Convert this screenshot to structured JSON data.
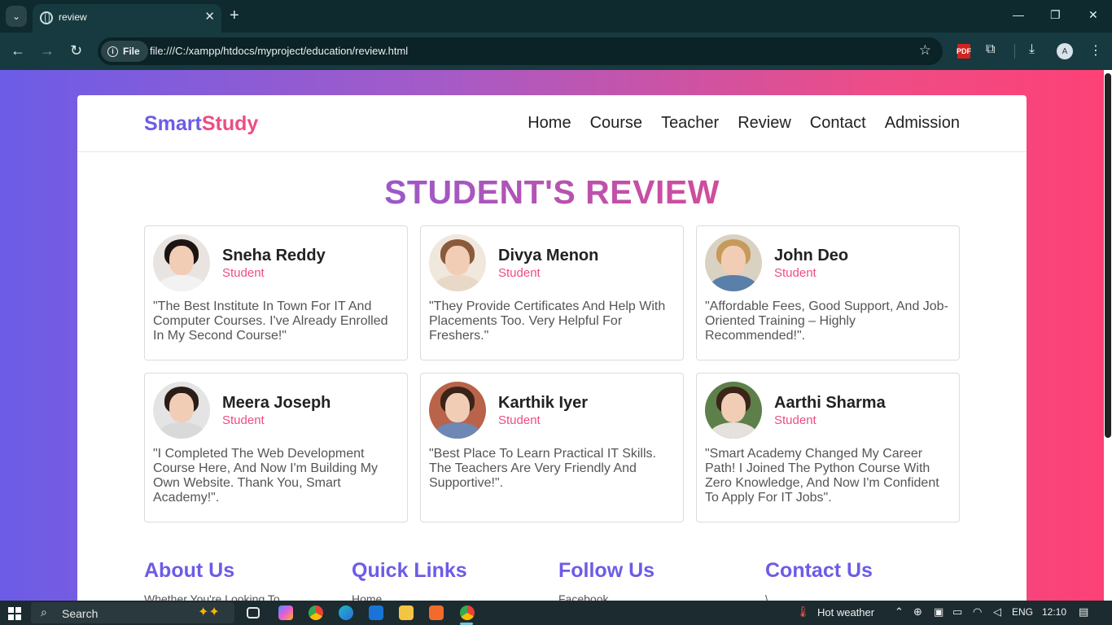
{
  "browser": {
    "tab_title": "review",
    "tab_close": "✕",
    "new_tab": "+",
    "chip_label": "File",
    "url": "file:///C:/xampp/htdocs/myproject/education/review.html",
    "profile_initial": "A",
    "pdf_label": "PDF",
    "icons": {
      "back": "←",
      "forward": "→",
      "reload": "↻",
      "star": "☆",
      "extensions": "⧉",
      "download": "⤓",
      "menu": "⋮",
      "minimize": "—",
      "restore": "❐",
      "close": "✕",
      "tab_search": "⌄"
    }
  },
  "site": {
    "logo_part1": "Smart",
    "logo_part2": "Study",
    "nav": [
      "Home",
      "Course",
      "Teacher",
      "Review",
      "Contact",
      "Admission"
    ],
    "heading": "STUDENT'S REVIEW",
    "reviews": [
      {
        "name": "Sneha Reddy",
        "role": "Student",
        "quote": "\"The Best Institute In Town For IT And Computer Courses. I've Already Enrolled In My Second Course!\"",
        "bg": "#e9e4df",
        "hair": "#1c1412",
        "shirt": "#f2f2f2"
      },
      {
        "name": "Divya Menon",
        "role": "Student",
        "quote": "\"They Provide Certificates And Help With Placements Too. Very Helpful For Freshers.\"",
        "bg": "#f0e7dd",
        "hair": "#8a5a3a",
        "shirt": "#e8d8c8"
      },
      {
        "name": "John Deo",
        "role": "Student",
        "quote": "\"Affordable Fees, Good Support, And Job-Oriented Training – Highly Recommended!\".",
        "bg": "#d9d2c2",
        "hair": "#c69a5a",
        "shirt": "#5a7fa8"
      },
      {
        "name": "Meera Joseph",
        "role": "Student",
        "quote": "\"I Completed The Web Development Course Here, And Now I'm Building My Own Website. Thank You, Smart Academy!\".",
        "bg": "#e4e4e4",
        "hair": "#2a1d18",
        "shirt": "#d9d9d9"
      },
      {
        "name": "Karthik Iyer",
        "role": "Student",
        "quote": "\"Best Place To Learn Practical IT Skills. The Teachers Are Very Friendly And Supportive!\".",
        "bg": "#b9634a",
        "hair": "#3a2418",
        "shirt": "#6d88b5"
      },
      {
        "name": "Aarthi Sharma",
        "role": "Student",
        "quote": "\"Smart Academy Changed My Career Path! I Joined The Python Course With Zero Knowledge, And Now I'm Confident To Apply For IT Jobs\".",
        "bg": "#5d7f4a",
        "hair": "#3b2418",
        "shirt": "#e6e1dc"
      }
    ],
    "footer": [
      {
        "title": "About Us",
        "sub": "Whether You're Looking To"
      },
      {
        "title": "Quick Links",
        "sub": "Home"
      },
      {
        "title": "Follow Us",
        "sub": "Facebook"
      },
      {
        "title": "Contact Us",
        "sub": "\\"
      }
    ]
  },
  "taskbar": {
    "search_placeholder": "Search",
    "weather": "Hot weather",
    "lang": "ENG",
    "time": "12:10"
  },
  "colors": {
    "accent_purple": "#6c5ce7",
    "accent_pink": "#ee4c86"
  }
}
